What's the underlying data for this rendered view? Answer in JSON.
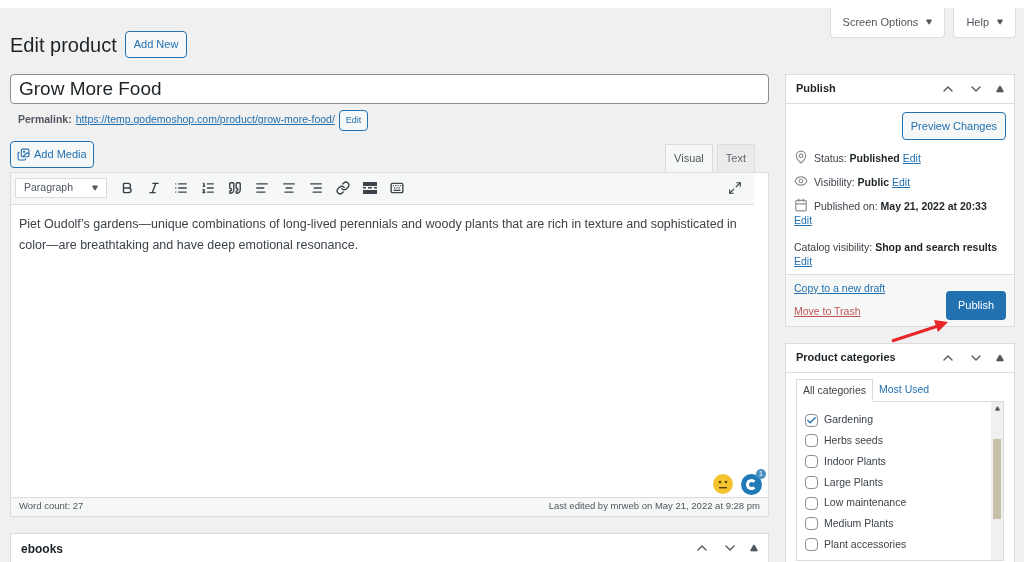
{
  "top_buttons": [
    {
      "label": "Screen Options"
    },
    {
      "label": "Help"
    }
  ],
  "page_title": "Edit product",
  "add_new": "Add New",
  "title_field": {
    "value": "Grow More Food"
  },
  "permalink": {
    "label": "Permalink:",
    "url": "https://temp.godemoshop.com/product/grow-more-food/",
    "edit": "Edit"
  },
  "add_media": "Add Media",
  "editor_tabs": [
    {
      "label": "Visual",
      "selected": true
    },
    {
      "label": "Text",
      "selected": false
    }
  ],
  "format_select": {
    "value": "Paragraph"
  },
  "content": "Piet Oudolf’s gardens—unique combinations of long-lived perennials and woody plants that are rich in texture and sophisticated in color—are breathtaking and have deep emotional resonance.",
  "grammarly_badge": "1",
  "word_count": "Word count: 27",
  "last_edited": "Last edited by mrweb on May 21, 2022 at 9:28 pm",
  "ebooks_box": {
    "title": "ebooks"
  },
  "publish_box": {
    "title": "Publish",
    "preview": "Preview Changes",
    "meta": [
      {
        "kind": "pin",
        "text": "Status: **Published**",
        "edit": "Edit"
      },
      {
        "kind": "eye",
        "text": "Visibility: **Public**",
        "edit": "Edit"
      },
      {
        "kind": "calendar",
        "text": "Published on: **May 21, 2022 at 20:33**",
        "edit": "Edit"
      },
      {
        "kind": "plain",
        "text": "Catalog visibility: **Shop and search results**",
        "edit": "Edit"
      }
    ],
    "copy_link": "Copy to a new draft",
    "trash_link": "Move to Trash",
    "publish_button": "Publish"
  },
  "categories_box": {
    "title": "Product categories",
    "tabs": [
      {
        "label": "All categories",
        "selected": true
      },
      {
        "label": "Most Used",
        "selected": false
      }
    ],
    "items": [
      {
        "label": "Gardening",
        "checked": true
      },
      {
        "label": "Herbs seeds",
        "checked": false
      },
      {
        "label": "Indoor Plants",
        "checked": false
      },
      {
        "label": "Large Plants",
        "checked": false
      },
      {
        "label": "Low maintenance",
        "checked": false
      },
      {
        "label": "Medium Plants",
        "checked": false
      },
      {
        "label": "Plant accessories",
        "checked": false
      }
    ]
  }
}
